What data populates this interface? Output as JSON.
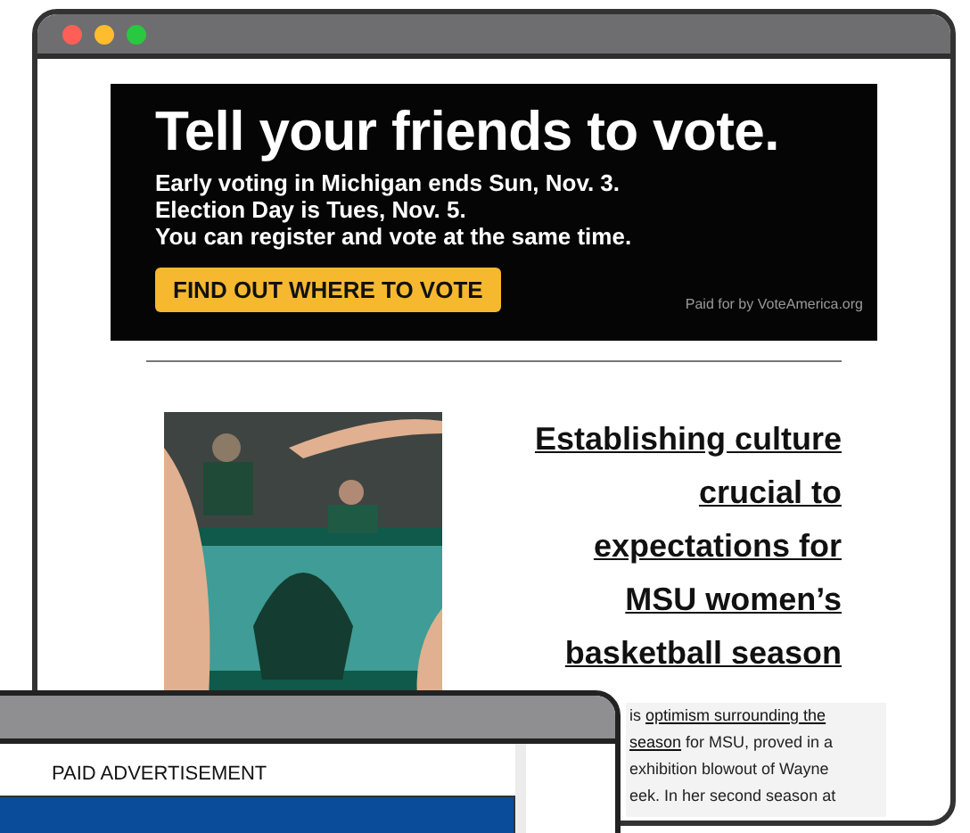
{
  "main_window": {
    "banner_ad": {
      "headline": "Tell your friends to vote.",
      "lines": [
        "Early voting in Michigan ends Sun, Nov. 3.",
        "Election Day is Tues, Nov. 5.",
        "You can register and vote at the same time."
      ],
      "button": "FIND OUT WHERE TO VOTE",
      "disclaimer": "Paid for by VoteAmerica.org"
    },
    "article": {
      "photo": {
        "kind": "picture"
      },
      "headline_lines": [
        "Establishing culture",
        "crucial to",
        "expectations for",
        "MSU women’s",
        "basketball season"
      ],
      "excerpt_lines": [
        [
          {
            "kind": "text",
            "text": "is "
          },
          {
            "kind": "link",
            "text": "optimism surrounding the"
          }
        ],
        [
          {
            "kind": "link",
            "text": "season"
          },
          {
            "kind": "text",
            "text": " for MSU, proved in a"
          }
        ],
        [
          {
            "kind": "text",
            "text": "exhibition blowout of Wayne"
          }
        ],
        [
          {
            "kind": "text",
            "text": "eek. In her second season at"
          }
        ]
      ]
    }
  },
  "front_window": {
    "label": "PAID ADVERTISEMENT"
  }
}
